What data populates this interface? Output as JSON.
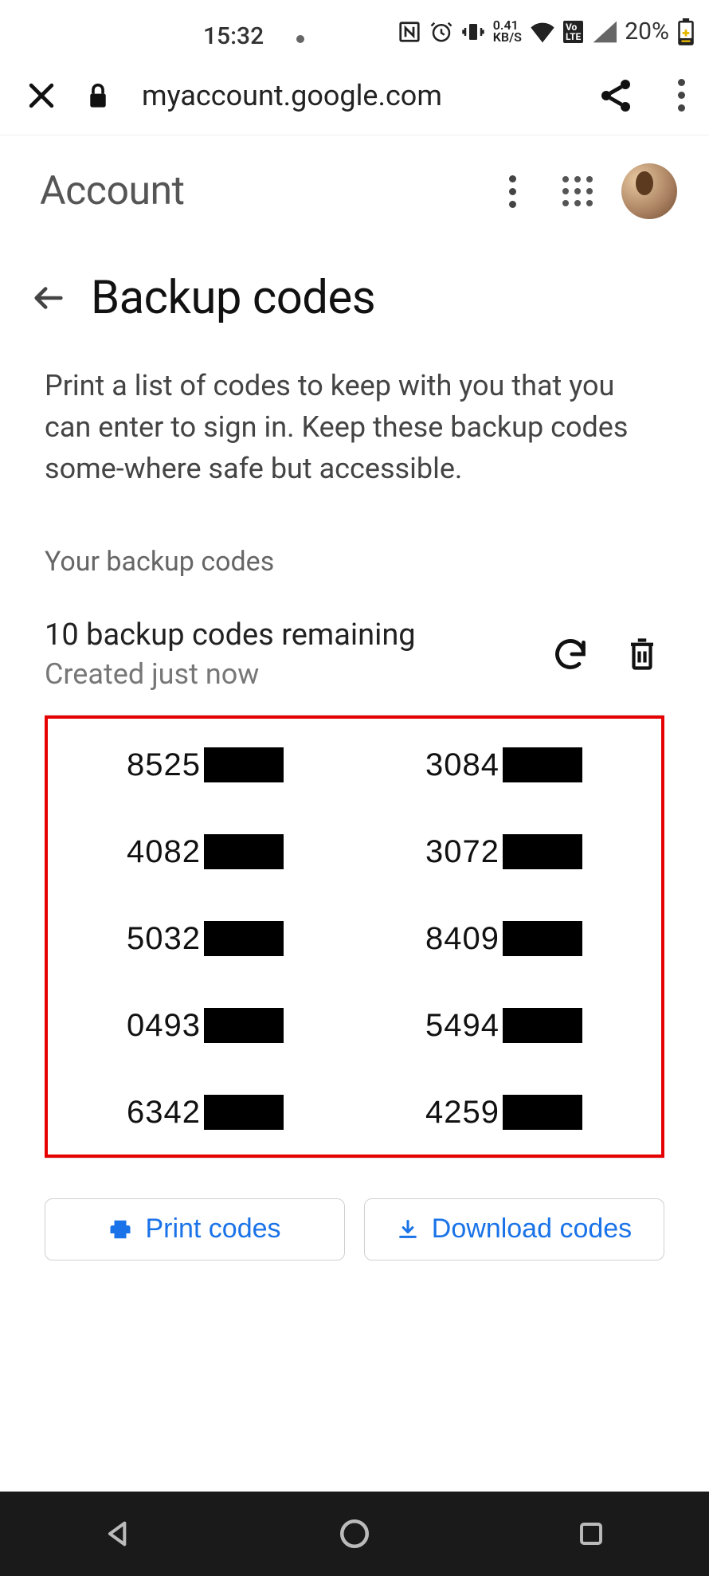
{
  "status": {
    "time": "15:32",
    "net_speed_top": "0.41",
    "net_speed_bottom": "KB/S",
    "volte": "VoLTE",
    "battery_pct": "20%"
  },
  "browser": {
    "url": "myaccount.google.com"
  },
  "header": {
    "title": "Account"
  },
  "page": {
    "title": "Backup codes",
    "description": "Print a list of codes to keep with you that you can enter to sign in. Keep these backup codes some‑where safe but accessible.",
    "section_label": "Your backup codes",
    "remaining_line": "10 backup codes remaining",
    "created_line": "Created just now"
  },
  "codes": {
    "col1": [
      "8525",
      "4082",
      "5032",
      "0493",
      "6342"
    ],
    "col2": [
      "3084",
      "3072",
      "8409",
      "5494",
      "4259"
    ]
  },
  "actions": {
    "print": "Print codes",
    "download": "Download codes"
  }
}
